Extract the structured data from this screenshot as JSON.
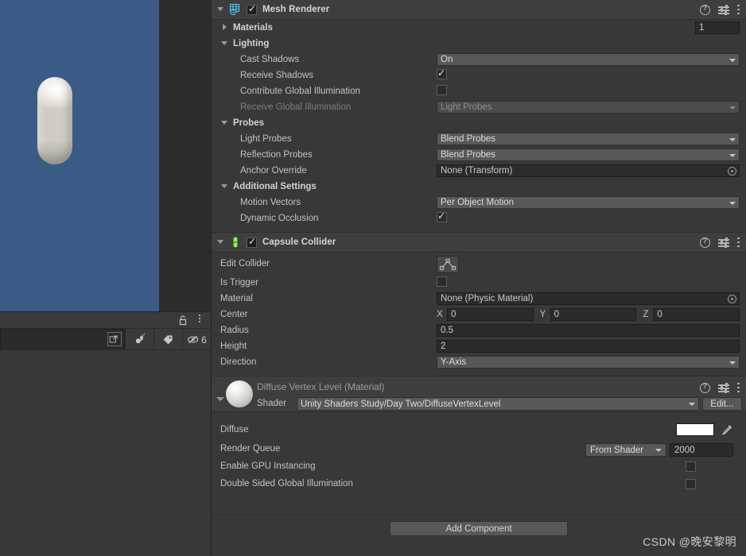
{
  "scene": {
    "object_name": "capsule-preview"
  },
  "scene_footer": {
    "lock_icon": "lock-open-icon",
    "menu_icon": "kebab-menu-icon",
    "search_placeholder": "",
    "search_value": "",
    "popout_icon": "popout-icon",
    "audio_icon": "audio-toggle-icon",
    "tag_icon": "gizmo-tag-icon",
    "visibility_icon": "visibility-off-icon",
    "visibility_count": "6"
  },
  "mesh_renderer": {
    "title": "Mesh Renderer",
    "icon": "mesh-renderer-icon",
    "enabled": true,
    "help_icon": "help-icon",
    "preset_icon": "preset-icon",
    "menu_icon": "kebab-menu-icon",
    "materials": {
      "label": "Materials",
      "count": "1",
      "expanded": false
    },
    "lighting": {
      "label": "Lighting",
      "expanded": true,
      "rows": [
        {
          "label": "Cast Shadows",
          "type": "dropdown",
          "value": "On",
          "dim": false
        },
        {
          "label": "Receive Shadows",
          "type": "checkbox",
          "checked": true
        },
        {
          "label": "Contribute Global Illumination",
          "type": "checkbox",
          "checked": false
        },
        {
          "label": "Receive Global Illumination",
          "type": "dropdown",
          "value": "Light Probes",
          "dim": true
        }
      ]
    },
    "probes": {
      "label": "Probes",
      "expanded": true,
      "rows": [
        {
          "label": "Light Probes",
          "type": "dropdown",
          "value": "Blend Probes"
        },
        {
          "label": "Reflection Probes",
          "type": "dropdown",
          "value": "Blend Probes"
        },
        {
          "label": "Anchor Override",
          "type": "object",
          "value": "None (Transform)"
        }
      ]
    },
    "additional_settings": {
      "label": "Additional Settings",
      "expanded": true,
      "rows": [
        {
          "label": "Motion Vectors",
          "type": "dropdown",
          "value": "Per Object Motion"
        },
        {
          "label": "Dynamic Occlusion",
          "type": "checkbox",
          "checked": true
        }
      ]
    }
  },
  "capsule_collider": {
    "title": "Capsule Collider",
    "icon": "capsule-collider-icon",
    "enabled": true,
    "help_icon": "help-icon",
    "preset_icon": "preset-icon",
    "menu_icon": "kebab-menu-icon",
    "edit_collider": {
      "label": "Edit Collider",
      "button_icon": "edit-collider-icon"
    },
    "is_trigger": {
      "label": "Is Trigger",
      "checked": false
    },
    "material": {
      "label": "Material",
      "value": "None (Physic Material)"
    },
    "center": {
      "label": "Center",
      "x_axis": "X",
      "x": "0",
      "y_axis": "Y",
      "y": "0",
      "z_axis": "Z",
      "z": "0"
    },
    "radius": {
      "label": "Radius",
      "value": "0.5"
    },
    "height": {
      "label": "Height",
      "value": "2"
    },
    "direction": {
      "label": "Direction",
      "value": "Y-Axis"
    }
  },
  "material_block": {
    "title": "Diffuse Vertex Level (Material)",
    "preview_icon": "material-sphere-preview",
    "help_icon": "help-icon",
    "preset_icon": "preset-icon",
    "menu_icon": "kebab-menu-icon",
    "shader_label": "Shader",
    "shader_value": "Unity Shaders Study/Day Two/DiffuseVertexLevel",
    "edit_button": "Edit...",
    "diffuse": {
      "label": "Diffuse",
      "color": "#ffffff",
      "eyedropper_icon": "eyedropper-icon"
    },
    "render_queue": {
      "label": "Render Queue",
      "mode": "From Shader",
      "value": "2000"
    },
    "gpu_instancing": {
      "label": "Enable GPU Instancing",
      "checked": false
    },
    "double_sided_gi": {
      "label": "Double Sided Global Illumination",
      "checked": false
    }
  },
  "footer": {
    "add_component": "Add Component",
    "watermark": "CSDN @晚安黎明"
  }
}
